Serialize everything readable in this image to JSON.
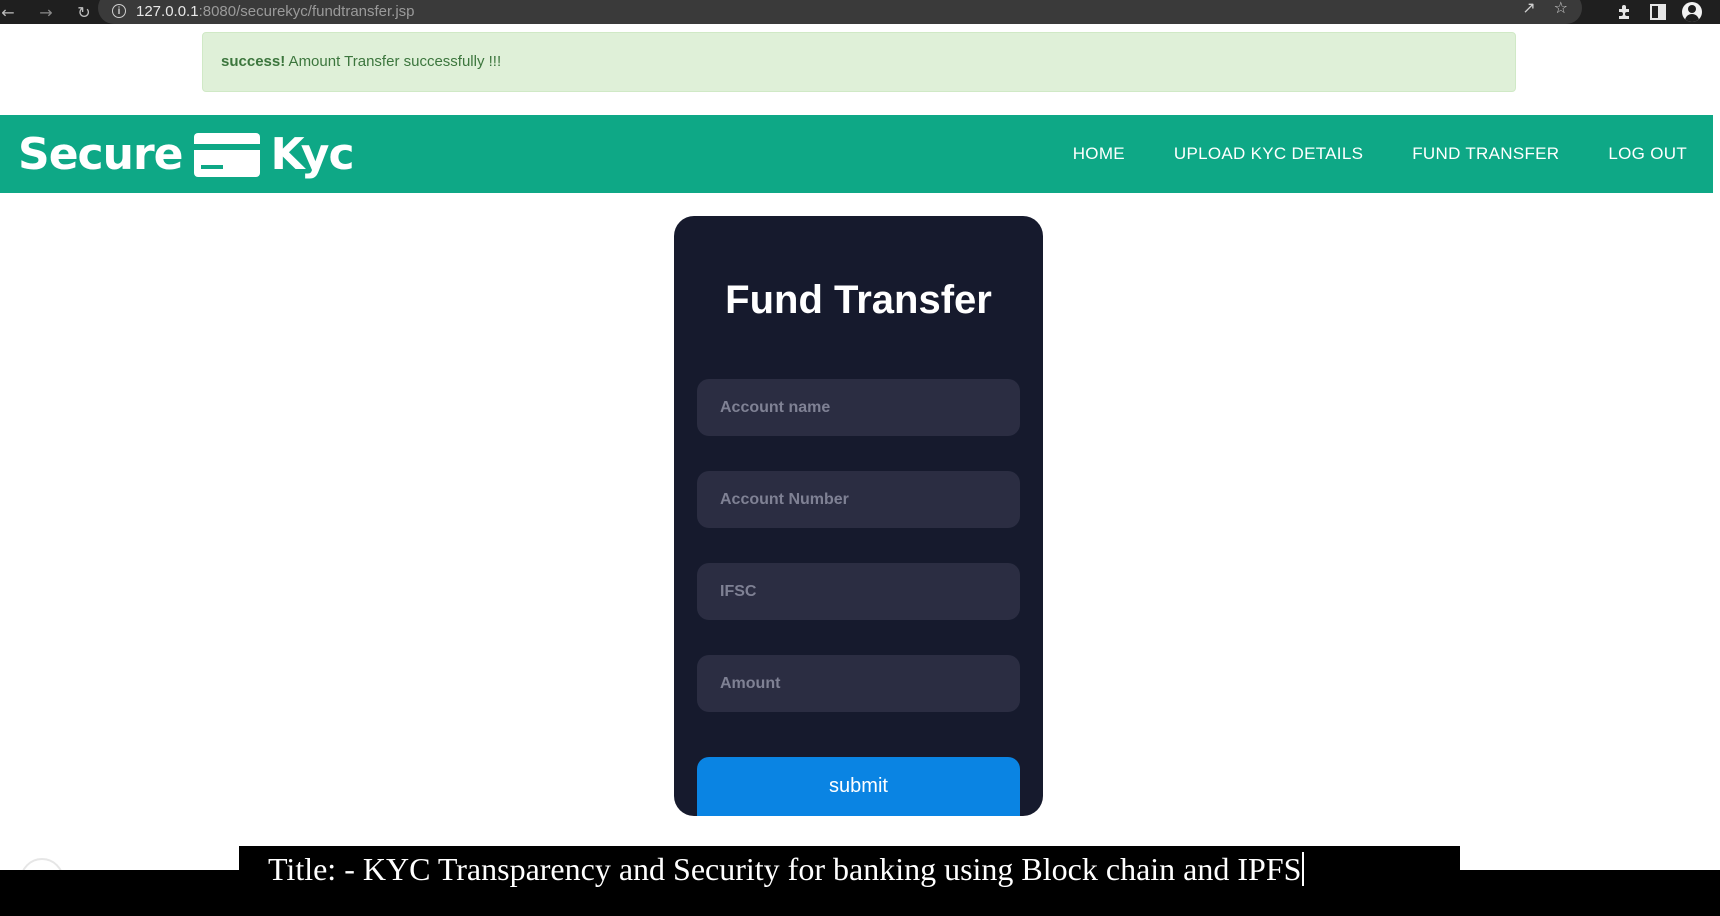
{
  "browser": {
    "url_host": "127.0.0.1",
    "url_path": ":8080/securekyc/fundtransfer.jsp",
    "icons": [
      "back-icon",
      "forward-icon",
      "reload-icon",
      "info-icon",
      "share-icon",
      "star-icon",
      "extensions-icon",
      "side-panel-icon",
      "profile-icon"
    ]
  },
  "alert": {
    "strong": "success!",
    "message": " Amount Transfer successfully !!!",
    "color": "#dff0d8"
  },
  "navbar": {
    "logo_left": "Secure",
    "logo_right": "Kyc",
    "brand_color": "#0ea886",
    "links": [
      "HOME",
      "UPLOAD KYC DETAILS",
      "FUND TRANSFER",
      "LOG OUT"
    ]
  },
  "form": {
    "title": "Fund Transfer",
    "fields": [
      {
        "placeholder": "Account name",
        "value": ""
      },
      {
        "placeholder": "Account Number",
        "value": ""
      },
      {
        "placeholder": "IFSC",
        "value": ""
      },
      {
        "placeholder": "Amount",
        "value": ""
      }
    ],
    "submit_label": "submit",
    "card_color": "#161a2d",
    "button_color": "#0a84e3"
  },
  "caption": {
    "text": "Title: - KYC Transparency and Security for banking using Block chain and IPFS"
  }
}
